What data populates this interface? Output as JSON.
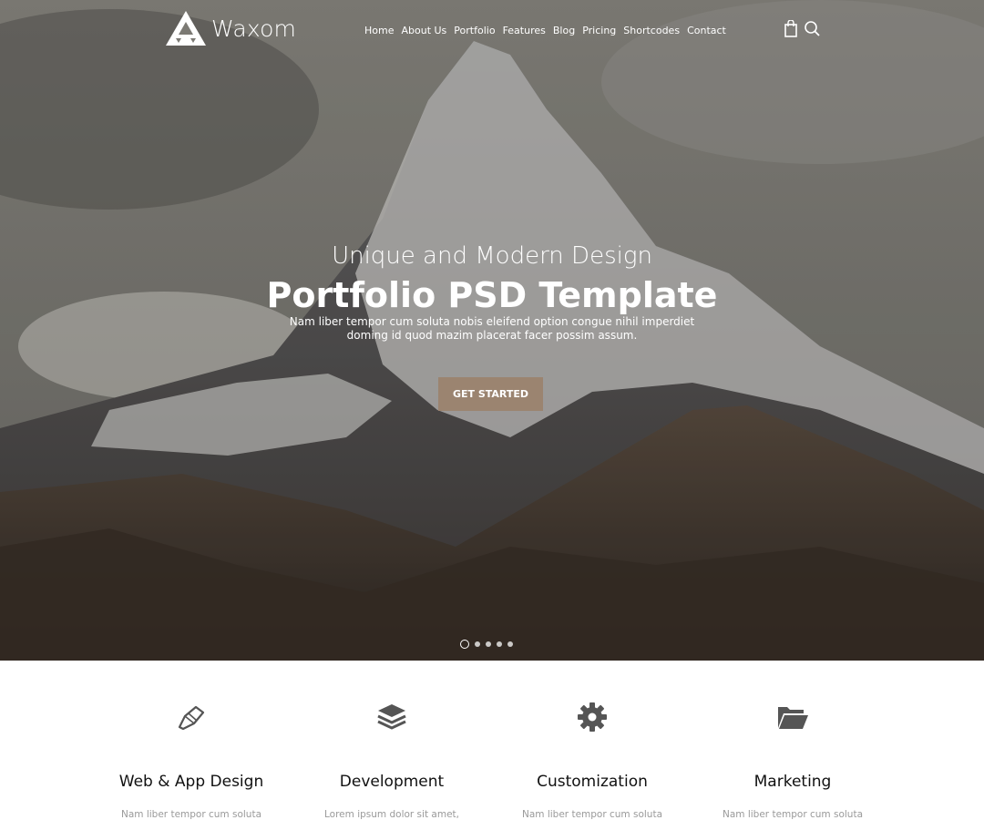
{
  "brand": {
    "name": "Waxom",
    "logo_icon": "triangle-logo-icon"
  },
  "nav": {
    "items": [
      {
        "label": "Home"
      },
      {
        "label": "About Us"
      },
      {
        "label": "Portfolio"
      },
      {
        "label": "Features"
      },
      {
        "label": "Blog"
      },
      {
        "label": "Pricing"
      },
      {
        "label": "Shortcodes"
      },
      {
        "label": "Contact"
      }
    ],
    "icons": [
      "shopping-bag-icon",
      "search-icon"
    ]
  },
  "hero": {
    "subtitle": "Unique and Modern Design",
    "title": "Portfolio PSD Template",
    "description_line1": "Nam liber tempor cum soluta nobis eleifend option congue nihil imperdiet",
    "description_line2": "doming id quod mazim placerat facer possim assum.",
    "cta_label": "GET STARTED",
    "slides_total": 5,
    "active_slide": 1
  },
  "features": [
    {
      "icon": "pen-icon",
      "title": "Web & App Design",
      "desc": "Nam liber tempor cum soluta"
    },
    {
      "icon": "layers-icon",
      "title": "Development",
      "desc": "Lorem ipsum dolor sit amet,"
    },
    {
      "icon": "gear-icon",
      "title": "Customization",
      "desc": "Nam liber tempor cum soluta"
    },
    {
      "icon": "folder-icon",
      "title": "Marketing",
      "desc": "Nam liber tempor cum soluta"
    }
  ],
  "colors": {
    "accent": "#9b8470",
    "icon": "#555555"
  }
}
